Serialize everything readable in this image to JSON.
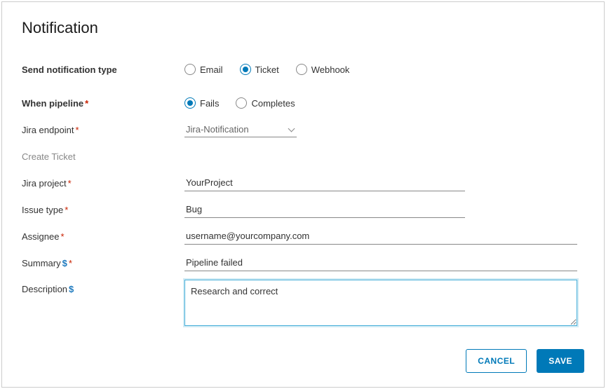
{
  "title": "Notification",
  "labels": {
    "notificationType": "Send notification type",
    "whenPipeline": "When pipeline",
    "jiraEndpoint": "Jira endpoint",
    "createTicket": "Create Ticket",
    "jiraProject": "Jira project",
    "issueType": "Issue type",
    "assignee": "Assignee",
    "summary": "Summary",
    "description": "Description"
  },
  "notificationType": {
    "options": {
      "email": "Email",
      "ticket": "Ticket",
      "webhook": "Webhook"
    },
    "selected": "ticket"
  },
  "whenPipeline": {
    "options": {
      "fails": "Fails",
      "completes": "Completes"
    },
    "selected": "fails"
  },
  "jiraEndpoint": {
    "value": "Jira-Notification"
  },
  "jiraProject": {
    "value": "YourProject"
  },
  "issueType": {
    "value": "Bug"
  },
  "assignee": {
    "value": "username@yourcompany.com"
  },
  "summary": {
    "value": "Pipeline failed"
  },
  "description": {
    "value": "Research and correct"
  },
  "buttons": {
    "cancel": "CANCEL",
    "save": "SAVE"
  }
}
